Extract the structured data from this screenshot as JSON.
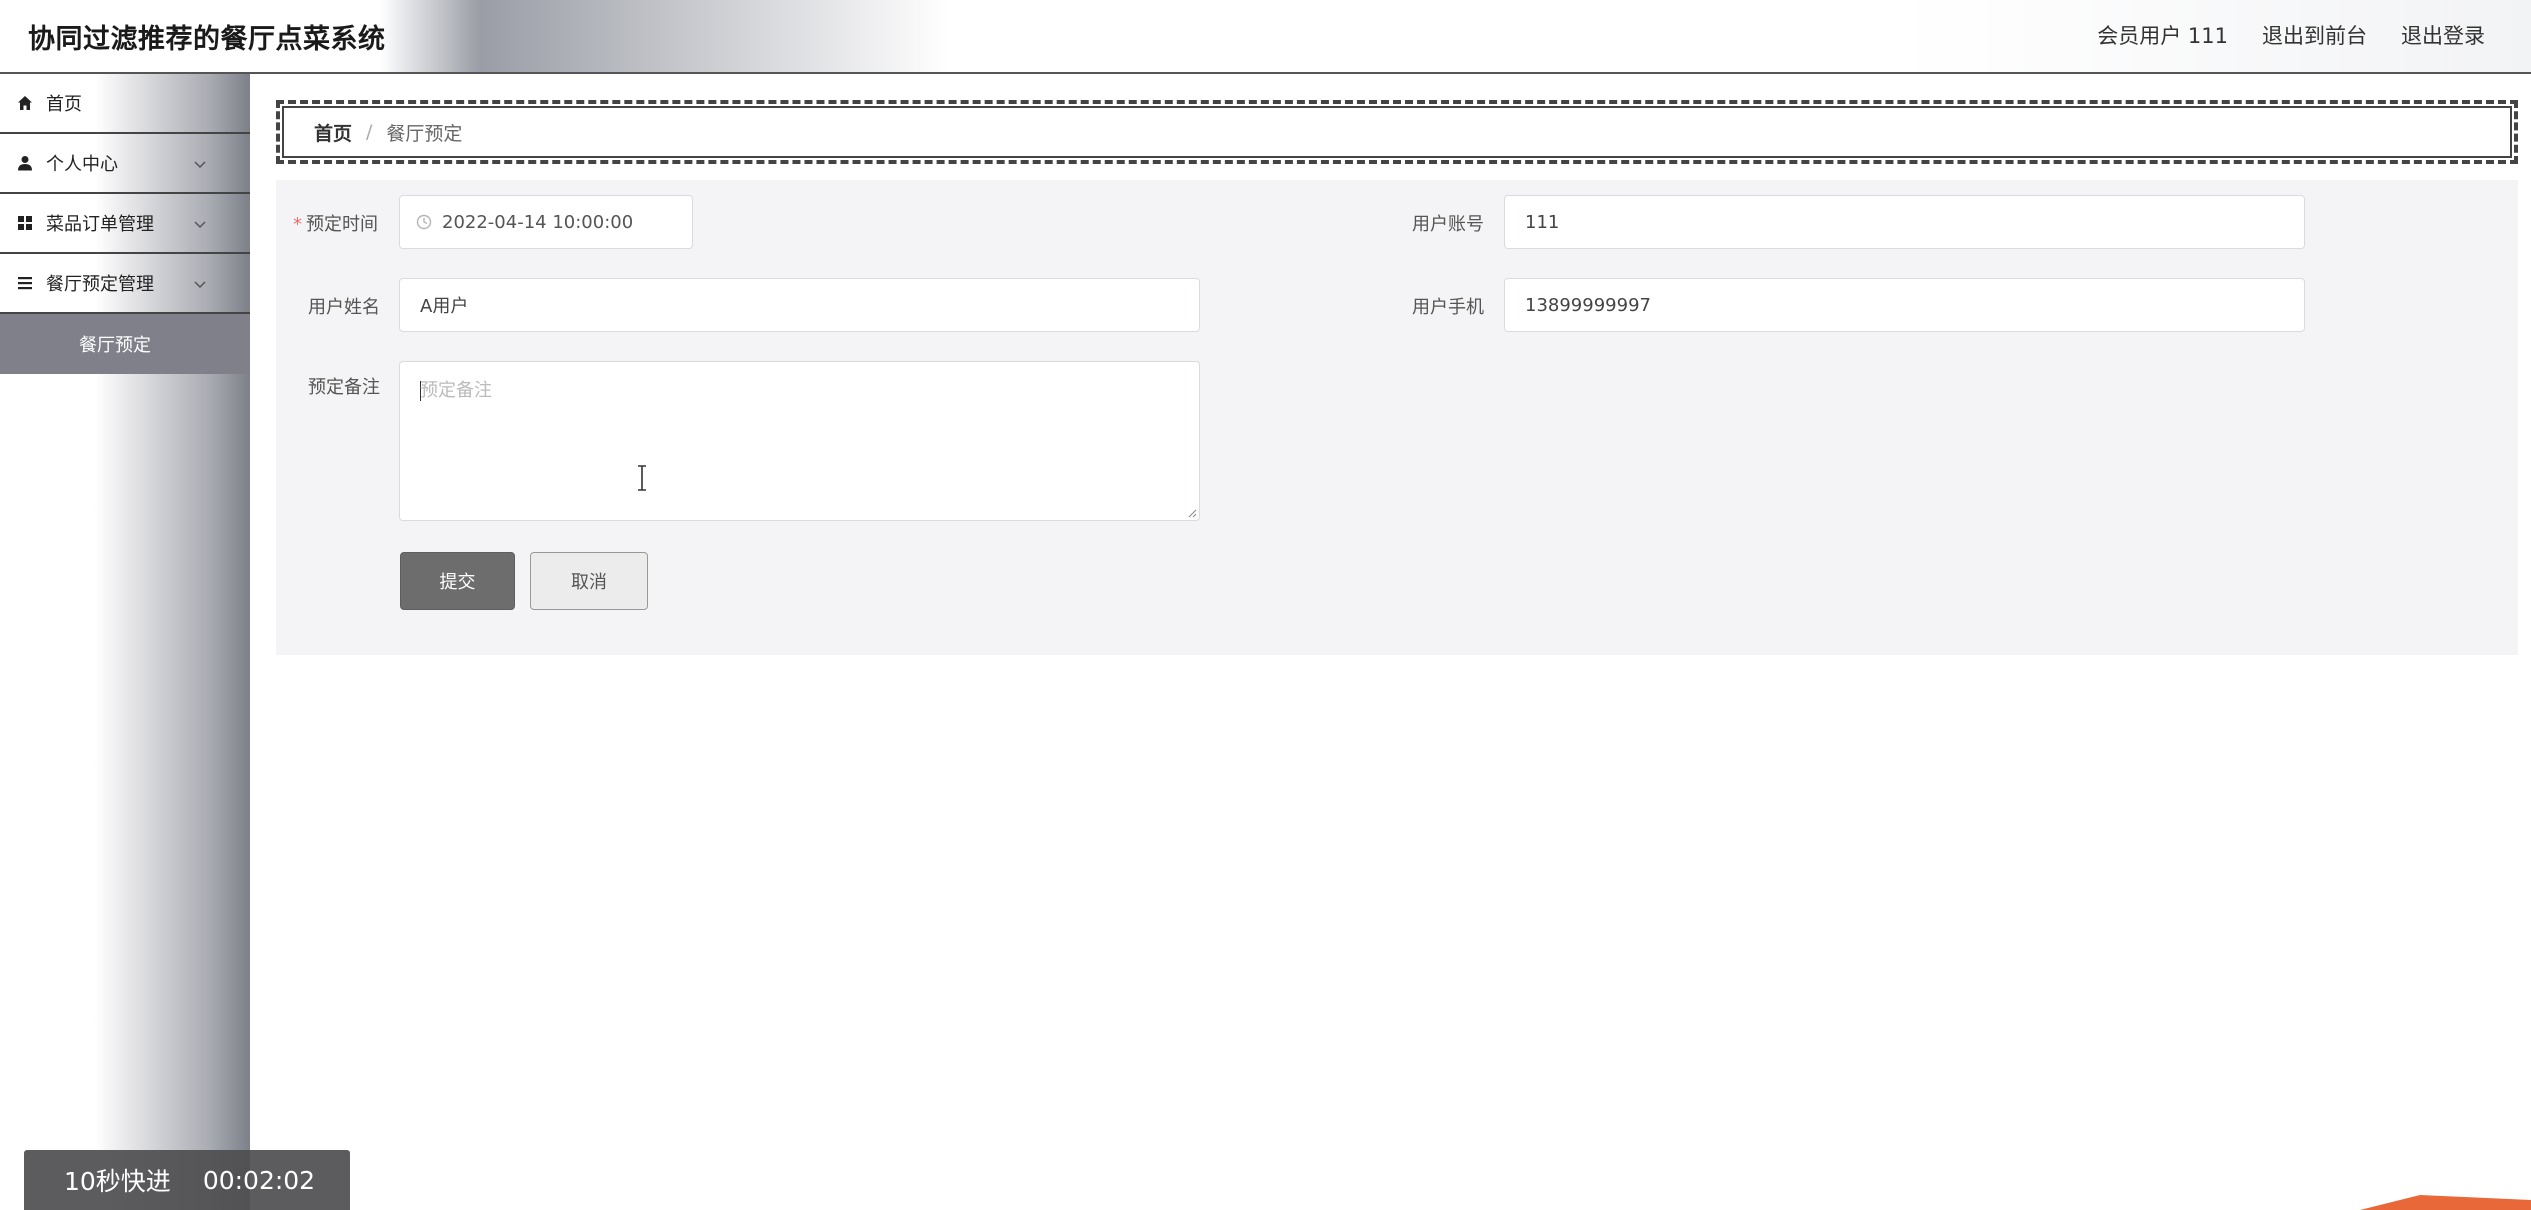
{
  "header": {
    "title": "协同过滤推荐的餐厅点菜系统",
    "links": [
      "会员用户 111",
      "退出到前台",
      "退出登录"
    ]
  },
  "sidebar": {
    "items": [
      {
        "label": "首页",
        "icon": "home-icon"
      },
      {
        "label": "个人中心",
        "icon": "user-icon",
        "expandable": true
      },
      {
        "label": "菜品订单管理",
        "icon": "grid-icon",
        "expandable": true
      },
      {
        "label": "餐厅预定管理",
        "icon": "list-icon",
        "expandable": true
      }
    ],
    "active_sub": "餐厅预定"
  },
  "breadcrumb": {
    "home": "首页",
    "separator": "/",
    "current": "餐厅预定"
  },
  "form": {
    "reserve_time_label": "预定时间",
    "reserve_time_required": "*",
    "reserve_time_value": "2022-04-14 10:00:00",
    "account_label": "用户账号",
    "account_value": "111",
    "name_label": "用户姓名",
    "name_value": "A用户",
    "phone_label": "用户手机",
    "phone_value": "13899999997",
    "note_label": "预定备注",
    "note_placeholder": "预定备注",
    "submit_label": "提交",
    "cancel_label": "取消"
  },
  "overlay": {
    "fast_forward": "10秒快进",
    "time": "00:02:02"
  },
  "colors": {
    "primary_button": "#6d6d6e",
    "panel_bg": "#f4f3f5",
    "active_menu_bg": "#7f8089",
    "required": "#f56c6c"
  }
}
